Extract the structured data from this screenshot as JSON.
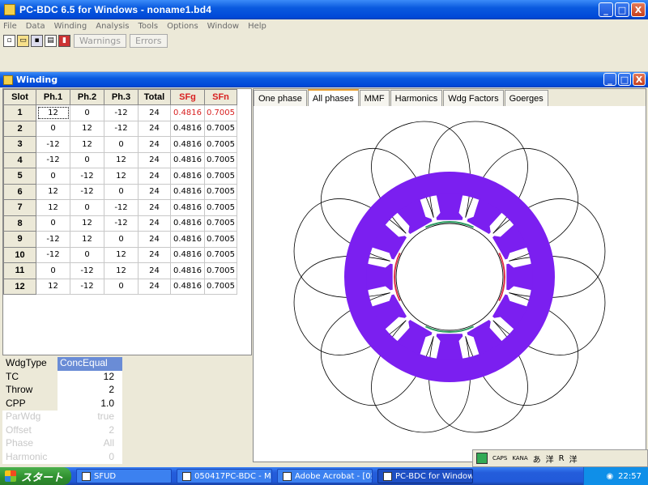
{
  "app": {
    "title": "PC-BDC 6.5 for Windows - noname1.bd4",
    "controls": [
      "_",
      "□",
      "X"
    ]
  },
  "menu": [
    "File",
    "Data",
    "Winding",
    "Analysis",
    "Tools",
    "Options",
    "Window",
    "Help"
  ],
  "toolbar": {
    "warnings_label": "Warnings",
    "errors_label": "Errors"
  },
  "child_window": {
    "title": "Winding"
  },
  "table": {
    "headers": [
      "Slot",
      "Ph.1",
      "Ph.2",
      "Ph.3",
      "Total",
      "SFg",
      "SFn"
    ],
    "rows": [
      [
        "1",
        "12",
        "0",
        "-12",
        "24",
        "0.4816",
        "0.7005"
      ],
      [
        "2",
        "0",
        "12",
        "-12",
        "24",
        "0.4816",
        "0.7005"
      ],
      [
        "3",
        "-12",
        "12",
        "0",
        "24",
        "0.4816",
        "0.7005"
      ],
      [
        "4",
        "-12",
        "0",
        "12",
        "24",
        "0.4816",
        "0.7005"
      ],
      [
        "5",
        "0",
        "-12",
        "12",
        "24",
        "0.4816",
        "0.7005"
      ],
      [
        "6",
        "12",
        "-12",
        "0",
        "24",
        "0.4816",
        "0.7005"
      ],
      [
        "7",
        "12",
        "0",
        "-12",
        "24",
        "0.4816",
        "0.7005"
      ],
      [
        "8",
        "0",
        "12",
        "-12",
        "24",
        "0.4816",
        "0.7005"
      ],
      [
        "9",
        "-12",
        "12",
        "0",
        "24",
        "0.4816",
        "0.7005"
      ],
      [
        "10",
        "-12",
        "0",
        "12",
        "24",
        "0.4816",
        "0.7005"
      ],
      [
        "11",
        "0",
        "-12",
        "12",
        "24",
        "0.4816",
        "0.7005"
      ],
      [
        "12",
        "12",
        "-12",
        "0",
        "24",
        "0.4816",
        "0.7005"
      ]
    ]
  },
  "properties": [
    {
      "key": "WdgType",
      "value": "ConcEqual",
      "state": "highlight"
    },
    {
      "key": "TC",
      "value": "12",
      "state": "normal"
    },
    {
      "key": "Throw",
      "value": "2",
      "state": "normal"
    },
    {
      "key": "CPP",
      "value": "1.0",
      "state": "normal"
    },
    {
      "key": "ParWdg",
      "value": "true",
      "state": "dim"
    },
    {
      "key": "Offset",
      "value": "2",
      "state": "dim"
    },
    {
      "key": "Phase",
      "value": "All",
      "state": "dim"
    },
    {
      "key": "Harmonic",
      "value": "0",
      "state": "dim"
    }
  ],
  "tabs": [
    "One phase",
    "All phases",
    "MMF",
    "Harmonics",
    "Wdg Factors",
    "Goerges"
  ],
  "active_tab": "All phases",
  "colors": {
    "stator": "#7B1FF0",
    "red_text": "#D82020",
    "coil_line": "#000000",
    "magnet_red": "#E0304A",
    "magnet_green": "#2A9A60"
  },
  "diagram": {
    "slots": 12
  },
  "ime": {
    "labels": [
      "CAPS",
      "KANA",
      "あ",
      "洋",
      "R",
      "洋"
    ]
  },
  "taskbar": {
    "start_label": "スタート",
    "tasks": [
      "SFUD",
      "050417PC-BDC - Mi...",
      "Adobe Acrobat - [05...",
      "PC-BDC for Windows"
    ],
    "active_task": "PC-BDC for Windows",
    "clock": "22:57"
  }
}
